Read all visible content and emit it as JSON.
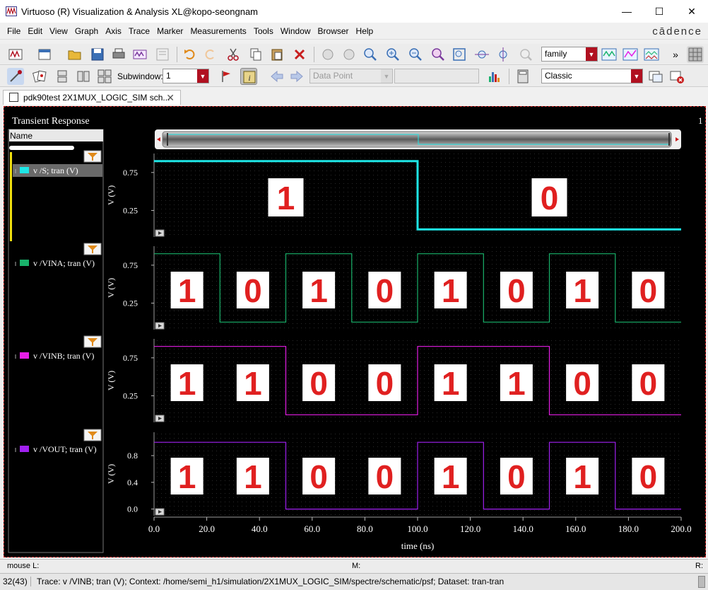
{
  "window": {
    "title": "Virtuoso (R) Visualization & Analysis XL@kopo-seongnam"
  },
  "menu": [
    "File",
    "Edit",
    "View",
    "Graph",
    "Axis",
    "Trace",
    "Marker",
    "Measurements",
    "Tools",
    "Window",
    "Browser",
    "Help"
  ],
  "brand": "cādence",
  "toolbar": {
    "family_combo": "family",
    "subwindow_label": "Subwindow:",
    "subwindow_value": "1",
    "data_point_combo": "Data Point",
    "style_combo": "Classic"
  },
  "tab": {
    "label": "pdk90test 2X1MUX_LOGIC_SIM sch..."
  },
  "graph": {
    "title": "Transient Response",
    "corner_number": "1",
    "name_header": "Name",
    "x_axis_label": "time (ns)"
  },
  "traces": [
    {
      "name": "v /S; tran (V)",
      "color": "#1ee6e6"
    },
    {
      "name": "v /VINA; tran (V)",
      "color": "#19b36b"
    },
    {
      "name": "v /VINB; tran (V)",
      "color": "#e61ee6"
    },
    {
      "name": "v /VOUT; tran (V)",
      "color": "#a020f0"
    }
  ],
  "chart_data": [
    {
      "type": "line",
      "series": [
        {
          "name": "v /S; tran (V)",
          "x": [
            0,
            100,
            100,
            200
          ],
          "y": [
            0.9,
            0.9,
            0,
            0
          ]
        }
      ],
      "ylabel": "V (V)",
      "yticks": [
        "0.75",
        "0.25"
      ],
      "xlim": [
        0,
        200
      ],
      "ylim": [
        -0.1,
        1.0
      ],
      "annotations": [
        "1",
        "0"
      ]
    },
    {
      "type": "line",
      "series": [
        {
          "name": "v /VINA; tran (V)",
          "x": [
            0,
            25,
            25,
            50,
            50,
            75,
            75,
            100,
            100,
            125,
            125,
            150,
            150,
            175,
            175,
            200
          ],
          "y": [
            0.9,
            0.9,
            0,
            0,
            0.9,
            0.9,
            0,
            0,
            0.9,
            0.9,
            0,
            0,
            0.9,
            0.9,
            0,
            0
          ]
        }
      ],
      "ylabel": "V (V)",
      "yticks": [
        "0.75",
        "0.25"
      ],
      "xlim": [
        0,
        200
      ],
      "ylim": [
        -0.1,
        1.0
      ],
      "annotations": [
        "1",
        "0",
        "1",
        "0",
        "1",
        "0",
        "1",
        "0"
      ]
    },
    {
      "type": "line",
      "series": [
        {
          "name": "v /VINB; tran (V)",
          "x": [
            0,
            50,
            50,
            100,
            100,
            150,
            150,
            200
          ],
          "y": [
            0.9,
            0.9,
            0,
            0,
            0.9,
            0.9,
            0,
            0
          ]
        }
      ],
      "ylabel": "V (V)",
      "yticks": [
        "0.75",
        "0.25"
      ],
      "xlim": [
        0,
        200
      ],
      "ylim": [
        -0.1,
        1.0
      ],
      "annotations": [
        "1",
        "1",
        "0",
        "0",
        "1",
        "1",
        "0",
        "0"
      ]
    },
    {
      "type": "line",
      "series": [
        {
          "name": "v /VOUT; tran (V)",
          "x": [
            0,
            50,
            50,
            100,
            100,
            125,
            125,
            150,
            150,
            175,
            175,
            200
          ],
          "y": [
            1.0,
            1.0,
            0,
            0,
            1.0,
            1.0,
            0,
            0,
            1.0,
            1.0,
            0,
            0
          ]
        }
      ],
      "ylabel": "V (V)",
      "yticks": [
        "0.8",
        "0.4",
        "0.0"
      ],
      "xlim": [
        0,
        200
      ],
      "ylim": [
        -0.1,
        1.15
      ],
      "annotations": [
        "1",
        "1",
        "0",
        "0",
        "1",
        "0",
        "1",
        "0"
      ]
    }
  ],
  "x_ticks": [
    "0.0",
    "20.0",
    "40.0",
    "60.0",
    "80.0",
    "100.0",
    "120.0",
    "140.0",
    "160.0",
    "180.0",
    "200.0"
  ],
  "status": {
    "mouse_l": "mouse L:",
    "mouse_m": "M:",
    "mouse_r": "R:",
    "counter": "32(43)",
    "message": "Trace: v /VINB; tran (V); Context: /home/semi_h1/simulation/2X1MUX_LOGIC_SIM/spectre/schematic/psf; Dataset: tran-tran"
  }
}
